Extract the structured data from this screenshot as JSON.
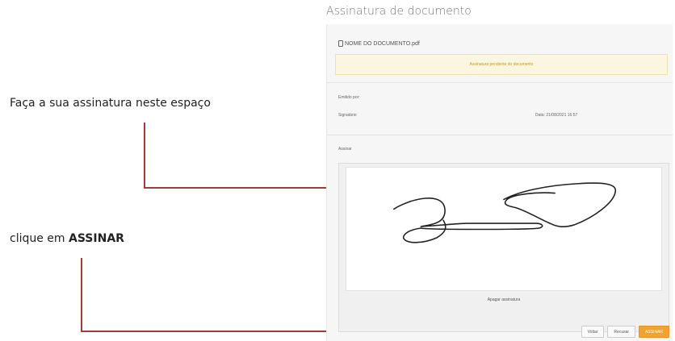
{
  "callouts": {
    "signature_hint": "Faça a sua assinatura neste espaço",
    "sign_hint_prefix": "clique em ",
    "sign_hint_bold": "ASSINAR"
  },
  "dialog": {
    "title": "Assinatura de documento",
    "document_name": "NOME DO DOCUMENTO.pdf",
    "alert_text": "Assinatura pendente do documento",
    "emitted_label": "Emitido por:",
    "signer_label": "Signatário",
    "date_text": "Data: 21/08/2021 16:57",
    "pad_label": "Assinar",
    "clear_label": "Apagar assinatura",
    "buttons": {
      "back": "Voltar",
      "reject": "Recusar",
      "sign": "ASSINAR"
    }
  },
  "colors": {
    "callout_line": "#a33a3a",
    "primary_button": "#f0a232",
    "alert_bg": "#fbf6df"
  }
}
